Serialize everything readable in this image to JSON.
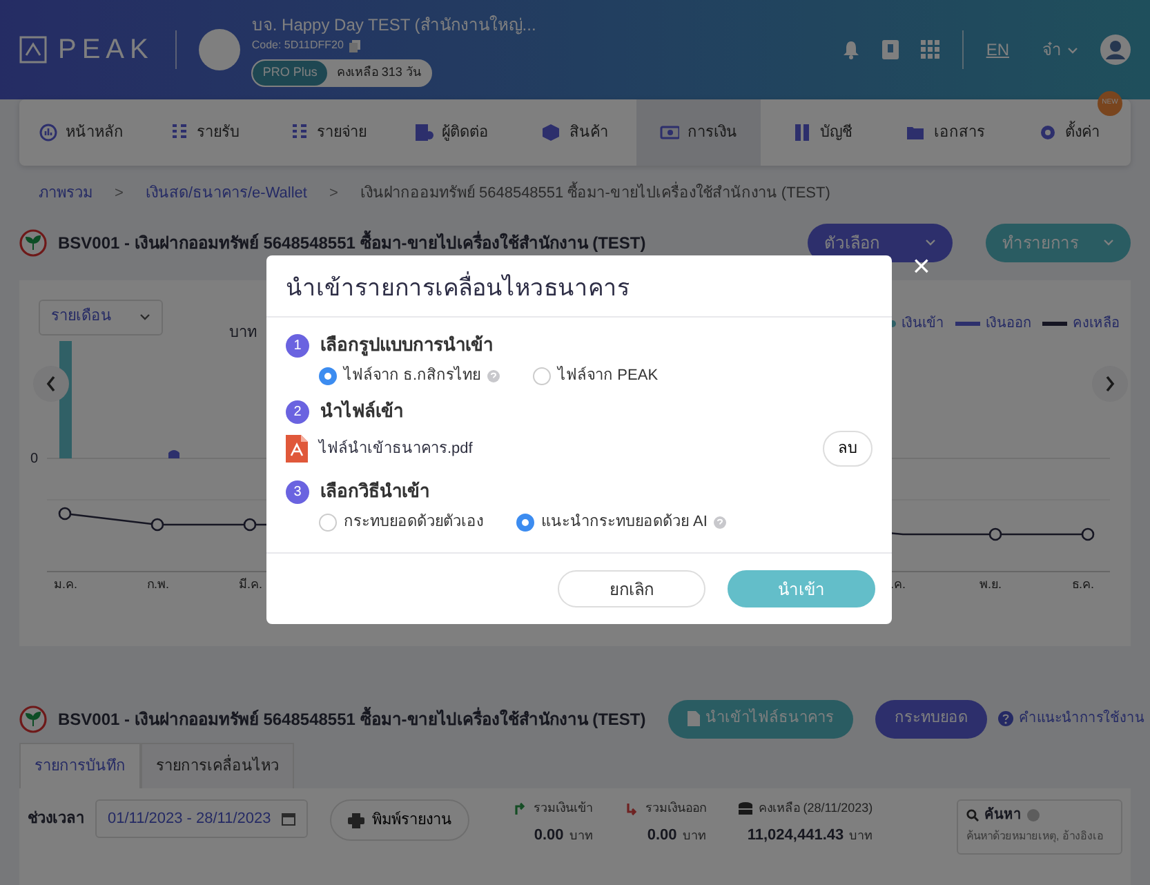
{
  "header": {
    "logo": "PEAK",
    "company_name": "บจ. Happy Day TEST (สำนักงานใหญ่...",
    "code": "Code: 5D11DFF20",
    "plan": "PRO Plus",
    "remaining": "คงเหลือ 313 วัน",
    "language": "EN",
    "user": "จ๋า"
  },
  "nav": [
    {
      "label": "หน้าหลัก",
      "selected": false
    },
    {
      "label": "รายรับ",
      "selected": false
    },
    {
      "label": "รายจ่าย",
      "selected": false
    },
    {
      "label": "ผู้ติดต่อ",
      "selected": false
    },
    {
      "label": "สินค้า",
      "selected": false
    },
    {
      "label": "การเงิน",
      "selected": true
    },
    {
      "label": "บัญชี",
      "selected": false
    },
    {
      "label": "เอกสาร",
      "selected": false
    },
    {
      "label": "ตั้งค่า",
      "selected": false,
      "badge": "NEW"
    }
  ],
  "breadcrumb_separator": ">",
  "breadcrumb": [
    "ภาพรวม",
    "เงินสด/ธนาคาร/e-Wallet",
    "เงินฝากออมทรัพย์ 5648548551 ซื้อมา-ขายไปเครื่องใช้สำนักงาน (TEST)"
  ],
  "account_title": "BSV001 - เงินฝากออมทรัพย์ 5648548551 ซื้อมา-ขายไปเครื่องใช้สำนักงาน (TEST)",
  "top_buttons": [
    {
      "label": "ตัวเลือก",
      "kind": "purple"
    },
    {
      "label": "ทำรายการ",
      "kind": "teal"
    }
  ],
  "chart": {
    "period": "รายเดือน",
    "unit": "บาท",
    "zero": "0",
    "legend": [
      {
        "label": "เงินเข้า",
        "color": "#306066"
      },
      {
        "label": "เงินออก",
        "color": "#2d306c"
      },
      {
        "label": "คงเหลือ",
        "color": "#161623"
      }
    ],
    "months_left": [
      "ม.ค.",
      "ก.พ.",
      "มี.ค."
    ],
    "months_right": [
      ".ค.",
      "พ.ย.",
      "ธ.ค."
    ]
  },
  "modal": {
    "title": "นำเข้ารายการเคลื่อนไหวธนาคาร",
    "close": "×",
    "steps": [
      {
        "number": "1",
        "title": "เลือกรูปแบบการนำเข้า",
        "kind": "radios",
        "options": [
          {
            "label": "ไฟล์จาก ธ.กสิกรไทย",
            "selected": true,
            "help": true
          },
          {
            "label": "ไฟล์จาก PEAK",
            "selected": false,
            "help": false
          }
        ]
      },
      {
        "number": "2",
        "title": "นำไฟล์เข้า",
        "kind": "file",
        "file_name": "ไฟล์นำเข้าธนาคาร.pdf",
        "remove": "ลบ"
      },
      {
        "number": "3",
        "title": "เลือกวิธีนำเข้า",
        "kind": "radios",
        "options": [
          {
            "label": "กระทบยอดด้วยตัวเอง",
            "selected": false,
            "help": false
          },
          {
            "label": "แนะนำกระทบยอดด้วย AI",
            "selected": true,
            "help": true
          }
        ]
      }
    ],
    "buttons": [
      {
        "label": "ยกเลิก",
        "kind": "secondary"
      },
      {
        "label": "นำเข้า",
        "kind": "primary"
      }
    ]
  },
  "section": {
    "title": "BSV001 - เงินฝากออมทรัพย์ 5648548551 ซื้อมา-ขายไปเครื่องใช้สำนักงาน (TEST)",
    "buttons": [
      {
        "label": "นำเข้าไฟล์ธนาคาร",
        "kind": "teal"
      },
      {
        "label": "กระทบยอด",
        "kind": "purple"
      }
    ],
    "guide": "คำแนะนำการใช้งาน",
    "tabs": [
      {
        "label": "รายการบันทึก",
        "selected": true
      },
      {
        "label": "รายการเคลื่อนไหว",
        "selected": false
      }
    ],
    "period_label": "ช่วงเวลา",
    "date_range": "01/11/2023 - 28/11/2023",
    "print": "พิมพ์รายงาน",
    "totals": [
      {
        "label": "รวมเงินเข้า",
        "value": "0.00",
        "unit": "บาท",
        "kind": "in"
      },
      {
        "label": "รวมเงินออก",
        "value": "0.00",
        "unit": "บาท",
        "kind": "out"
      },
      {
        "label": "คงเหลือ (28/11/2023)",
        "value": "11,024,441.43",
        "unit": "บาท",
        "kind": "balance"
      }
    ],
    "search": {
      "label": "ค้นหา",
      "placeholder": "ค้นหาด้วยหมายเหตุ, อ้างอิงเอ"
    }
  }
}
